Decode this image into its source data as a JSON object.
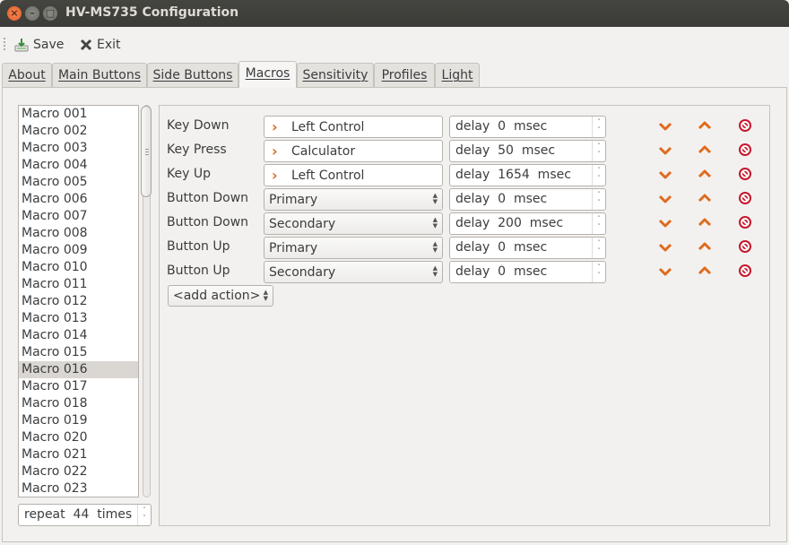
{
  "window": {
    "title": "HV-MS735 Configuration"
  },
  "toolbar": {
    "save_label": "Save",
    "exit_label": "Exit"
  },
  "tabs": [
    {
      "label": "About",
      "active": false
    },
    {
      "label": "Main Buttons",
      "active": false
    },
    {
      "label": "Side Buttons",
      "active": false
    },
    {
      "label": "Macros",
      "active": true
    },
    {
      "label": "Sensitivity",
      "active": false
    },
    {
      "label": "Profiles",
      "active": false
    },
    {
      "label": "Light",
      "active": false
    }
  ],
  "macro_list": {
    "items": [
      "Macro 001",
      "Macro 002",
      "Macro 003",
      "Macro 004",
      "Macro 005",
      "Macro 006",
      "Macro 007",
      "Macro 008",
      "Macro 009",
      "Macro 010",
      "Macro 011",
      "Macro 012",
      "Macro 013",
      "Macro 014",
      "Macro 015",
      "Macro 016",
      "Macro 017",
      "Macro 018",
      "Macro 019",
      "Macro 020",
      "Macro 021",
      "Macro 022",
      "Macro 023"
    ],
    "selected": "Macro 016"
  },
  "repeat": {
    "text": "repeat  44  times"
  },
  "actions": [
    {
      "label": "Key Down",
      "kind": "key",
      "value": "Left Control",
      "delay": "delay  0  msec"
    },
    {
      "label": "Key Press",
      "kind": "key",
      "value": "Calculator",
      "delay": "delay  50  msec"
    },
    {
      "label": "Key Up",
      "kind": "key",
      "value": "Left Control",
      "delay": "delay  1654  msec"
    },
    {
      "label": "Button Down",
      "kind": "button",
      "value": "Primary",
      "delay": "delay  0  msec"
    },
    {
      "label": "Button Down",
      "kind": "button",
      "value": "Secondary",
      "delay": "delay  200  msec"
    },
    {
      "label": "Button Up",
      "kind": "button",
      "value": "Primary",
      "delay": "delay  0  msec"
    },
    {
      "label": "Button Up",
      "kind": "button",
      "value": "Secondary",
      "delay": "delay  0  msec"
    }
  ],
  "add_action": {
    "label": "<add action>"
  },
  "icons": {
    "move_down": "chevron-down-icon",
    "move_up": "chevron-up-icon",
    "remove": "remove-icon"
  },
  "colors": {
    "accent": "#e06a1c",
    "remove": "#c7162b",
    "selection": "#dad7d3"
  }
}
